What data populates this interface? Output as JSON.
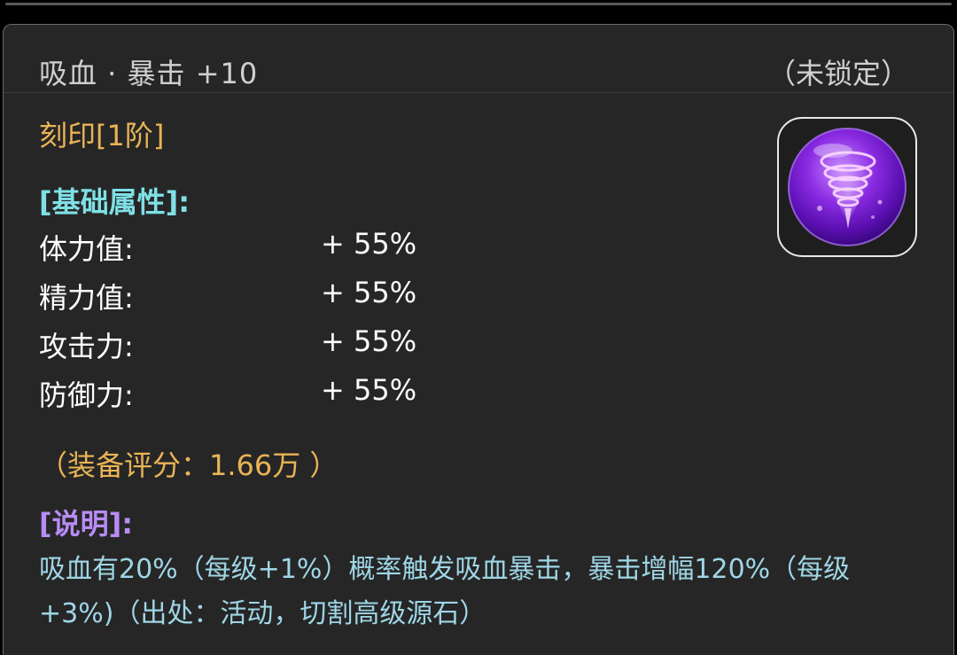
{
  "item": {
    "title": "吸血 · 暴击 +10",
    "lock_status": "（未锁定）",
    "rank": "刻印[1阶]",
    "icon": "purple-tornado-orb-icon"
  },
  "basic_attributes": {
    "header": "[基础属性]:",
    "stats": [
      {
        "name": "体力值:",
        "value": "+ 55%"
      },
      {
        "name": "精力值:",
        "value": "+ 55%"
      },
      {
        "name": "攻击力:",
        "value": "+ 55%"
      },
      {
        "name": "防御力:",
        "value": "+ 55%"
      }
    ]
  },
  "score": "（装备评分：1.66万 ）",
  "description": {
    "header": "[说明]:",
    "text": "吸血有20%（每级+1%）概率触发吸血暴击，暴击增幅120%（每级+3%)（出处：活动，切割高级源石）"
  },
  "colors": {
    "panel_bg": "#262626",
    "rank_gold": "#e9b456",
    "basic_header_cyan": "#7fe0e6",
    "desc_header_purple": "#b88cf5",
    "desc_text_blue": "#9fd6e6"
  }
}
